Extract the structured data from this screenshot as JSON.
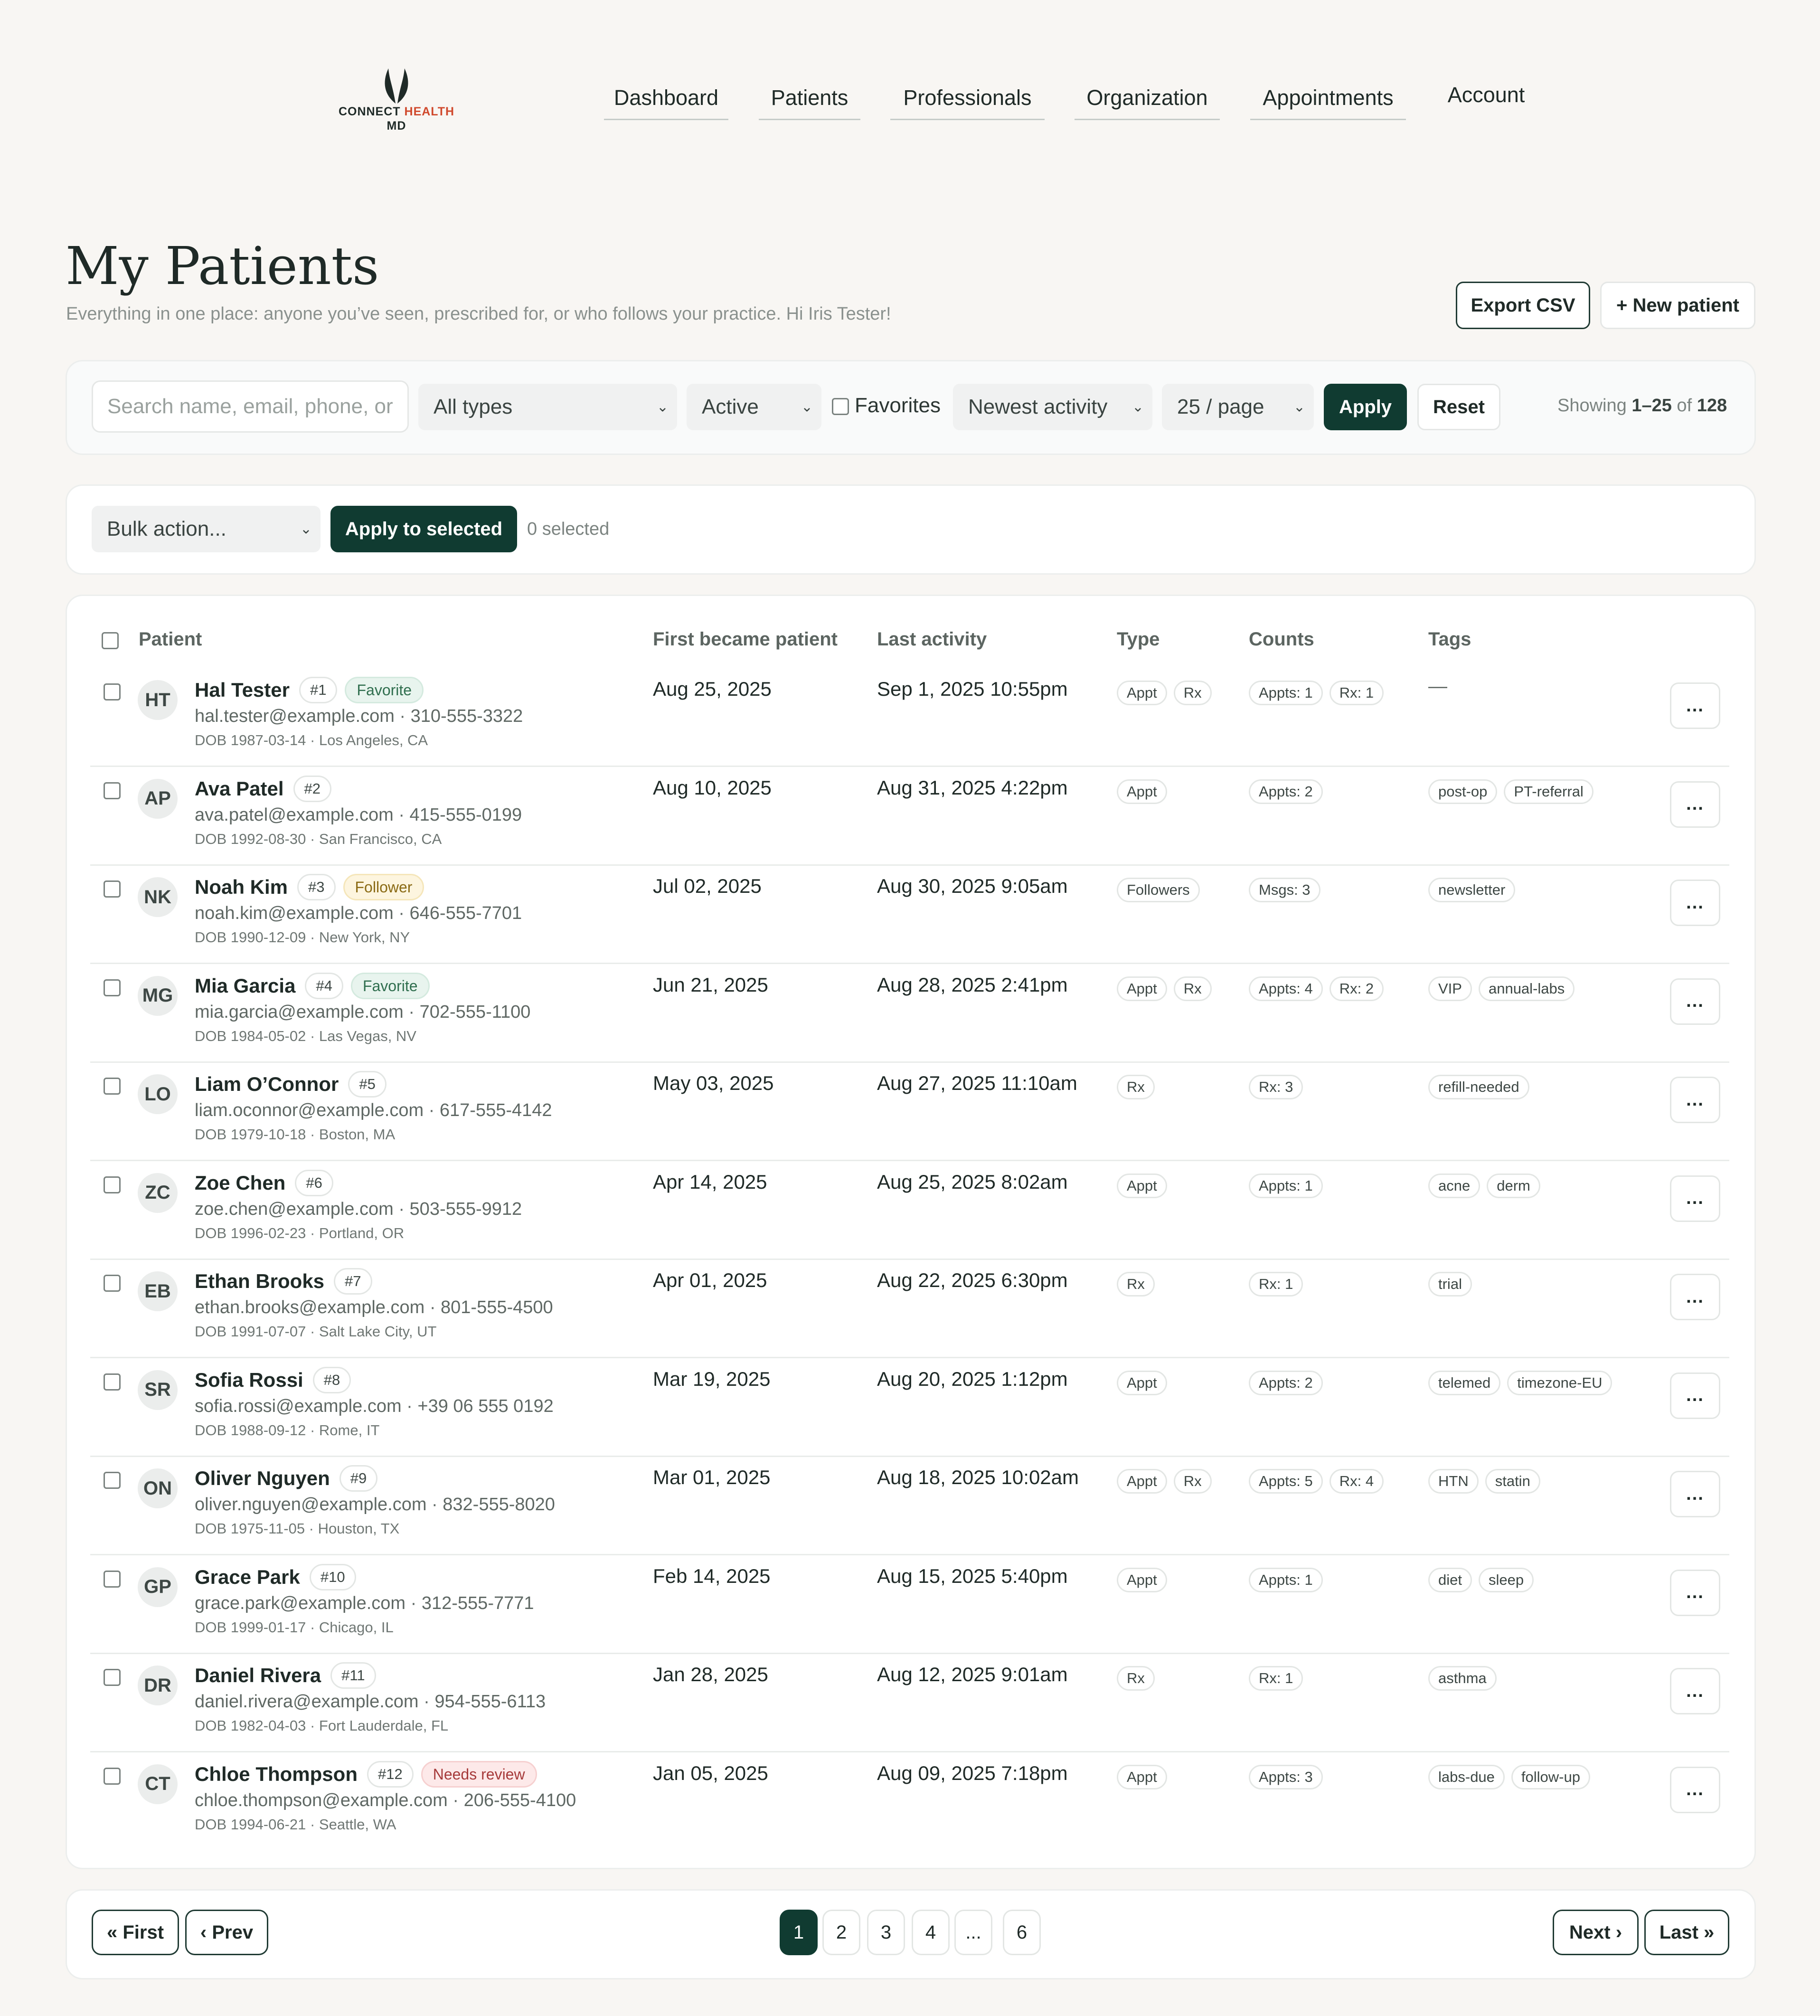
{
  "brand": {
    "name_part1": "CONNECT ",
    "name_part2": "HEALTH",
    "name_part3": "MD",
    "accent_color": "#d0492c",
    "logo_icon": "leaf-icon"
  },
  "nav": {
    "dashboard": "Dashboard",
    "patients": "Patients",
    "professionals": "Professionals",
    "organization": "Organization",
    "appointments": "Appointments",
    "account": "Account"
  },
  "page": {
    "title": "My Patients",
    "subtitle": "Everything in one place: anyone you’ve seen, prescribed for, or who follows your practice. Hi Iris Tester!",
    "export_label": "Export CSV",
    "new_patient_label": "+ New patient"
  },
  "filters": {
    "search_placeholder": "Search name, email, phone, or",
    "type_value": "All types",
    "status_value": "Active",
    "favorites_label": "Favorites",
    "sort_value": "Newest activity",
    "per_page_value": "25 / page",
    "apply_label": "Apply",
    "reset_label": "Reset",
    "showing_prefix": "Showing ",
    "showing_range": "1–25",
    "showing_mid": " of ",
    "showing_total": "128"
  },
  "bulk": {
    "select_value": "Bulk action...",
    "apply_label": "Apply to selected",
    "selected_text": "0 selected"
  },
  "table": {
    "headers": {
      "patient": "Patient",
      "first": "First became patient",
      "last": "Last activity",
      "type": "Type",
      "counts": "Counts",
      "tags": "Tags"
    },
    "more_label": "...",
    "empty_tags": "—",
    "rows": [
      {
        "initials": "HT",
        "name": "Hal Tester",
        "num": "#1",
        "badge": "Favorite",
        "badge_kind": "fav",
        "contact": "hal.tester@example.com · 310-555-3322",
        "dob": "DOB 1987-03-14 · Los Angeles, CA",
        "first": "Aug 25, 2025",
        "last": "Sep 1, 2025 10:55pm",
        "types": [
          "Appt",
          "Rx"
        ],
        "counts": [
          "Appts: 1",
          "Rx: 1"
        ],
        "tags": []
      },
      {
        "initials": "AP",
        "name": "Ava Patel",
        "num": "#2",
        "badge": "",
        "badge_kind": "",
        "contact": "ava.patel@example.com · 415-555-0199",
        "dob": "DOB 1992-08-30 · San Francisco, CA",
        "first": "Aug 10, 2025",
        "last": "Aug 31, 2025 4:22pm",
        "types": [
          "Appt"
        ],
        "counts": [
          "Appts: 2"
        ],
        "tags": [
          "post-op",
          "PT-referral"
        ]
      },
      {
        "initials": "NK",
        "name": "Noah Kim",
        "num": "#3",
        "badge": "Follower",
        "badge_kind": "fol",
        "contact": "noah.kim@example.com · 646-555-7701",
        "dob": "DOB 1990-12-09 · New York, NY",
        "first": "Jul 02, 2025",
        "last": "Aug 30, 2025 9:05am",
        "types": [
          "Followers"
        ],
        "counts": [
          "Msgs: 3"
        ],
        "tags": [
          "newsletter"
        ]
      },
      {
        "initials": "MG",
        "name": "Mia Garcia",
        "num": "#4",
        "badge": "Favorite",
        "badge_kind": "fav",
        "contact": "mia.garcia@example.com · 702-555-1100",
        "dob": "DOB 1984-05-02 · Las Vegas, NV",
        "first": "Jun 21, 2025",
        "last": "Aug 28, 2025 2:41pm",
        "types": [
          "Appt",
          "Rx"
        ],
        "counts": [
          "Appts: 4",
          "Rx: 2"
        ],
        "tags": [
          "VIP",
          "annual-labs"
        ]
      },
      {
        "initials": "LO",
        "name": "Liam O’Connor",
        "num": "#5",
        "badge": "",
        "badge_kind": "",
        "contact": "liam.oconnor@example.com · 617-555-4142",
        "dob": "DOB 1979-10-18 · Boston, MA",
        "first": "May 03, 2025",
        "last": "Aug 27, 2025 11:10am",
        "types": [
          "Rx"
        ],
        "counts": [
          "Rx: 3"
        ],
        "tags": [
          "refill-needed"
        ]
      },
      {
        "initials": "ZC",
        "name": "Zoe Chen",
        "num": "#6",
        "badge": "",
        "badge_kind": "",
        "contact": "zoe.chen@example.com · 503-555-9912",
        "dob": "DOB 1996-02-23 · Portland, OR",
        "first": "Apr 14, 2025",
        "last": "Aug 25, 2025 8:02am",
        "types": [
          "Appt"
        ],
        "counts": [
          "Appts: 1"
        ],
        "tags": [
          "acne",
          "derm"
        ]
      },
      {
        "initials": "EB",
        "name": "Ethan Brooks",
        "num": "#7",
        "badge": "",
        "badge_kind": "",
        "contact": "ethan.brooks@example.com · 801-555-4500",
        "dob": "DOB 1991-07-07 · Salt Lake City, UT",
        "first": "Apr 01, 2025",
        "last": "Aug 22, 2025 6:30pm",
        "types": [
          "Rx"
        ],
        "counts": [
          "Rx: 1"
        ],
        "tags": [
          "trial"
        ]
      },
      {
        "initials": "SR",
        "name": "Sofia Rossi",
        "num": "#8",
        "badge": "",
        "badge_kind": "",
        "contact": "sofia.rossi@example.com · +39 06 555 0192",
        "dob": "DOB 1988-09-12 · Rome, IT",
        "first": "Mar 19, 2025",
        "last": "Aug 20, 2025 1:12pm",
        "types": [
          "Appt"
        ],
        "counts": [
          "Appts: 2"
        ],
        "tags": [
          "telemed",
          "timezone-EU"
        ]
      },
      {
        "initials": "ON",
        "name": "Oliver Nguyen",
        "num": "#9",
        "badge": "",
        "badge_kind": "",
        "contact": "oliver.nguyen@example.com · 832-555-8020",
        "dob": "DOB 1975-11-05 · Houston, TX",
        "first": "Mar 01, 2025",
        "last": "Aug 18, 2025 10:02am",
        "types": [
          "Appt",
          "Rx"
        ],
        "counts": [
          "Appts: 5",
          "Rx: 4"
        ],
        "tags": [
          "HTN",
          "statin"
        ]
      },
      {
        "initials": "GP",
        "name": "Grace Park",
        "num": "#10",
        "badge": "",
        "badge_kind": "",
        "contact": "grace.park@example.com · 312-555-7771",
        "dob": "DOB 1999-01-17 · Chicago, IL",
        "first": "Feb 14, 2025",
        "last": "Aug 15, 2025 5:40pm",
        "types": [
          "Appt"
        ],
        "counts": [
          "Appts: 1"
        ],
        "tags": [
          "diet",
          "sleep"
        ]
      },
      {
        "initials": "DR",
        "name": "Daniel Rivera",
        "num": "#11",
        "badge": "",
        "badge_kind": "",
        "contact": "daniel.rivera@example.com · 954-555-6113",
        "dob": "DOB 1982-04-03 · Fort Lauderdale, FL",
        "first": "Jan 28, 2025",
        "last": "Aug 12, 2025 9:01am",
        "types": [
          "Rx"
        ],
        "counts": [
          "Rx: 1"
        ],
        "tags": [
          "asthma"
        ]
      },
      {
        "initials": "CT",
        "name": "Chloe Thompson",
        "num": "#12",
        "badge": "Needs review",
        "badge_kind": "rev",
        "contact": "chloe.thompson@example.com · 206-555-4100",
        "dob": "DOB 1994-06-21 · Seattle, WA",
        "first": "Jan 05, 2025",
        "last": "Aug 09, 2025 7:18pm",
        "types": [
          "Appt"
        ],
        "counts": [
          "Appts: 3"
        ],
        "tags": [
          "labs-due",
          "follow-up"
        ]
      }
    ]
  },
  "pagination": {
    "first": "« First",
    "prev": "‹ Prev",
    "next": "Next ›",
    "last": "Last »",
    "pages": [
      "1",
      "2",
      "3",
      "4",
      "...",
      "6"
    ],
    "current": "1"
  }
}
